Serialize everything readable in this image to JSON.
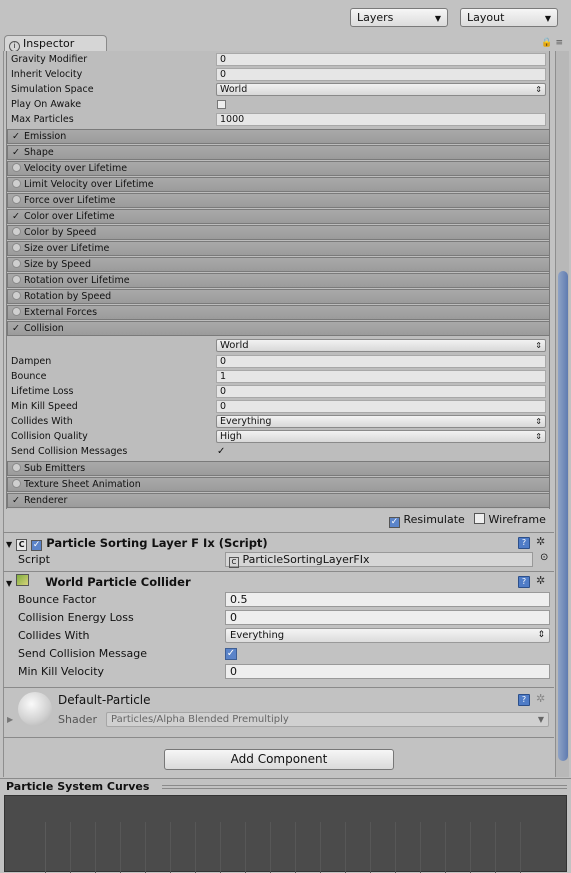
{
  "toolbar": {
    "layers": "Layers",
    "layout": "Layout"
  },
  "tab": {
    "label": "Inspector"
  },
  "particle_props": [
    {
      "label": "Gravity Modifier",
      "value": "0",
      "kind": "text"
    },
    {
      "label": "Inherit Velocity",
      "value": "0",
      "kind": "text"
    },
    {
      "label": "Simulation Space",
      "value": "World",
      "kind": "select"
    },
    {
      "label": "Play On Awake",
      "value": "",
      "kind": "checkbox",
      "checked": false
    },
    {
      "label": "Max Particles",
      "value": "1000",
      "kind": "text"
    }
  ],
  "modules": [
    {
      "label": "Emission",
      "enabled": true
    },
    {
      "label": "Shape",
      "enabled": true
    },
    {
      "label": "Velocity over Lifetime",
      "enabled": false
    },
    {
      "label": "Limit Velocity over Lifetime",
      "enabled": false
    },
    {
      "label": "Force over Lifetime",
      "enabled": false
    },
    {
      "label": "Color over Lifetime",
      "enabled": true
    },
    {
      "label": "Color by Speed",
      "enabled": false
    },
    {
      "label": "Size over Lifetime",
      "enabled": false
    },
    {
      "label": "Size by Speed",
      "enabled": false
    },
    {
      "label": "Rotation over Lifetime",
      "enabled": false
    },
    {
      "label": "Rotation by Speed",
      "enabled": false
    },
    {
      "label": "External Forces",
      "enabled": false
    },
    {
      "label": "Collision",
      "enabled": true
    }
  ],
  "collision": {
    "mode": "World",
    "props": [
      {
        "label": "Dampen",
        "value": "0",
        "kind": "text"
      },
      {
        "label": "Bounce",
        "value": "1",
        "kind": "text"
      },
      {
        "label": "Lifetime Loss",
        "value": "0",
        "kind": "text"
      },
      {
        "label": "Min Kill Speed",
        "value": "0",
        "kind": "text"
      },
      {
        "label": "Collides With",
        "value": "Everything",
        "kind": "select"
      },
      {
        "label": "Collision Quality",
        "value": "High",
        "kind": "select"
      },
      {
        "label": "Send Collision Messages",
        "value": "",
        "kind": "checkbox",
        "checked": true
      }
    ]
  },
  "modules_after": [
    {
      "label": "Sub Emitters",
      "enabled": false
    },
    {
      "label": "Texture Sheet Animation",
      "enabled": false
    },
    {
      "label": "Renderer",
      "enabled": true
    }
  ],
  "options": {
    "resimulate": "Resimulate",
    "wireframe": "Wireframe"
  },
  "sorting_script": {
    "title": "Particle Sorting Layer F Ix (Script)",
    "script_label": "Script",
    "script_value": "ParticleSortingLayerFIx"
  },
  "collider": {
    "title": "World Particle Collider",
    "props": [
      {
        "label": "Bounce Factor",
        "value": "0.5",
        "kind": "text"
      },
      {
        "label": "Collision Energy Loss",
        "value": "0",
        "kind": "text"
      },
      {
        "label": "Collides With",
        "value": "Everything",
        "kind": "select"
      },
      {
        "label": "Send Collision Message",
        "value": "",
        "kind": "checkbox",
        "checked": true
      },
      {
        "label": "Min Kill Velocity",
        "value": "0",
        "kind": "text"
      }
    ]
  },
  "material": {
    "name": "Default-Particle",
    "shader_label": "Shader",
    "shader_value": "Particles/Alpha Blended Premultiply"
  },
  "add_component": "Add Component",
  "curves": {
    "title": "Particle System Curves"
  }
}
